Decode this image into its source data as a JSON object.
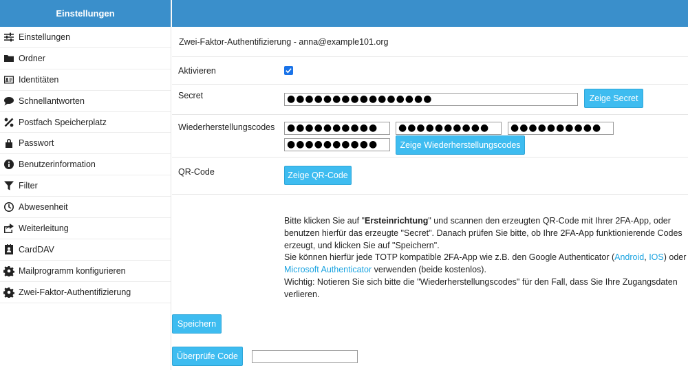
{
  "sidebar": {
    "header": "Einstellungen",
    "items": [
      {
        "label": "Einstellungen",
        "icon": "sliders-icon"
      },
      {
        "label": "Ordner",
        "icon": "folder-icon"
      },
      {
        "label": "Identitäten",
        "icon": "id-card-icon"
      },
      {
        "label": "Schnellantworten",
        "icon": "comment-icon"
      },
      {
        "label": "Postfach Speicherplatz",
        "icon": "percent-icon"
      },
      {
        "label": "Passwort",
        "icon": "lock-icon"
      },
      {
        "label": "Benutzerinformation",
        "icon": "info-icon"
      },
      {
        "label": "Filter",
        "icon": "filter-icon"
      },
      {
        "label": "Abwesenheit",
        "icon": "clock-icon"
      },
      {
        "label": "Weiterleitung",
        "icon": "share-icon"
      },
      {
        "label": "CardDAV",
        "icon": "address-book-icon"
      },
      {
        "label": "Mailprogramm konfigurieren",
        "icon": "gear-icon"
      },
      {
        "label": "Zwei-Faktor-Authentifizierung",
        "icon": "gear-icon"
      }
    ]
  },
  "main": {
    "title": "Zwei-Faktor-Authentifizierung - anna@example101.org",
    "activate_label": "Aktivieren",
    "activate_checked": true,
    "secret_label": "Secret",
    "secret_value": "●●●●●●●●●●●●●●●●",
    "show_secret_button": "Zeige Secret",
    "recovery_label": "Wiederherstellungscodes",
    "recovery_codes": [
      "●●●●●●●●●●",
      "●●●●●●●●●●",
      "●●●●●●●●●●",
      "●●●●●●●●●●"
    ],
    "show_recovery_button": "Zeige Wiederherstellungscodes",
    "qr_label": "QR-Code",
    "show_qr_button": "Zeige QR-Code",
    "info": {
      "p1_a": "Bitte klicken Sie auf \"",
      "p1_bold": "Ersteinrichtung",
      "p1_b": "\" und scannen den erzeugten QR-Code mit Ihrer 2FA-App, oder benutzen hierfür das erzeugte \"Secret\". Danach prüfen Sie bitte, ob Ihre 2FA-App funktionierende Codes erzeugt, und klicken Sie auf \"Speichern\".",
      "p2_a": "Sie können hierfür jede TOTP kompatible 2FA-App wie z.B. den Google Authenticator (",
      "link_android": "Android",
      "p2_sep": ", ",
      "link_ios": "IOS",
      "p2_b": ") oder ",
      "link_microsoft": "Microsoft Authenticator",
      "p2_c": " verwenden (beide kostenlos).",
      "p3": "Wichtig: Notieren Sie sich bitte die \"Wiederherstellungscodes\" für den Fall, dass Sie Ihre Zugangsdaten verlieren."
    },
    "save_button": "Speichern",
    "verify_button": "Überprüfe Code",
    "verify_input_value": ""
  },
  "colors": {
    "header": "#3a8fcb",
    "button": "#3ebcf0",
    "link": "#1aa3e0",
    "checkbox": "#1a73e8"
  }
}
